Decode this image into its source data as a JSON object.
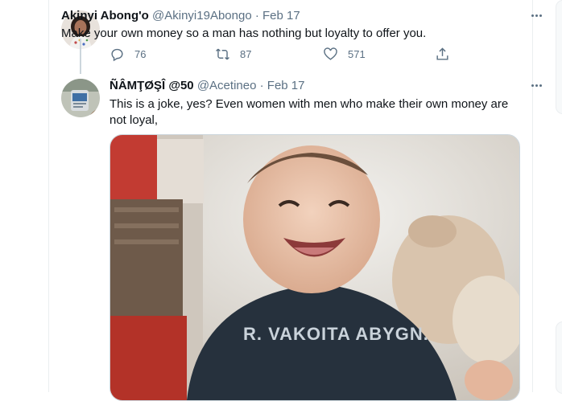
{
  "tweet1": {
    "name": "Akinyi Abong'o",
    "handle": "@Akinyi19Abongo",
    "separator": "·",
    "date": "Feb 17",
    "text": "Make your own money so a man has nothing but loyalty to offer you.",
    "replies": "76",
    "retweets": "87",
    "likes": "571"
  },
  "tweet2": {
    "name": "ÑÂMŢØŞÎ @50",
    "handle": "@Acetineo",
    "separator": "·",
    "date": "Feb 17",
    "text": "This is a joke, yes? Even women with men who make their own money are not loyal,",
    "media_shirt_text": "R. VAKOITA ABYGN."
  },
  "icons": [
    "more-icon",
    "reply-icon",
    "retweet-icon",
    "like-icon",
    "share-icon"
  ]
}
